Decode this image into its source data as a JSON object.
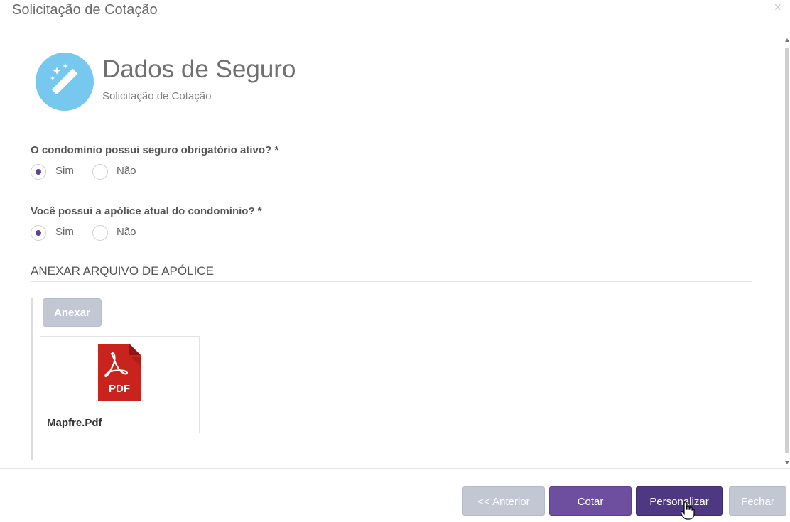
{
  "modal": {
    "title": "Solicitação de Cotação",
    "close_symbol": "×"
  },
  "header": {
    "icon": "magic-wand-icon",
    "title": "Dados de Seguro",
    "subtitle": "Solicitação de Cotação"
  },
  "questions": [
    {
      "label": "O condomínio possui seguro obrigatório ativo? *",
      "options": [
        "Sim",
        "Não"
      ],
      "selected": "Sim"
    },
    {
      "label": "Você possui a apólice atual do condomínio? *",
      "options": [
        "Sim",
        "Não"
      ],
      "selected": "Sim"
    }
  ],
  "attachments": {
    "section_title": "ANEXAR ARQUIVO DE APÓLICE",
    "attach_label": "Anexar",
    "files": [
      {
        "name": "Mapfre.Pdf",
        "icon": "pdf-file-icon",
        "icon_text": "PDF"
      }
    ]
  },
  "footer": {
    "previous_label": "<< Anterior",
    "quote_label": "Cotar",
    "customize_label": "Personalizar",
    "close_label": "Fechar"
  },
  "colors": {
    "accent": "#6d4e9f",
    "accent_dark": "#4f3882",
    "disabled": "#c3c6d3",
    "icon_circle": "#76c8ee",
    "pdf_red": "#c8231c"
  }
}
